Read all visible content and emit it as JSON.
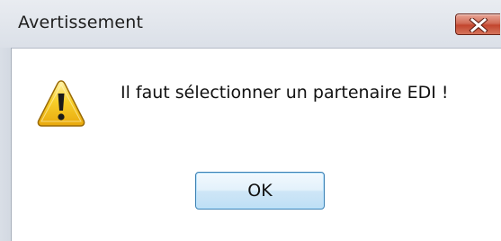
{
  "dialog": {
    "title": "Avertissement",
    "message": "Il faut sélectionner un partenaire EDI !",
    "ok_label": "OK",
    "icon": "warning-icon",
    "close_icon": "close-icon"
  },
  "colors": {
    "close_button": "#c7503a",
    "warning_yellow": "#f5c61f",
    "button_border": "#3c7fb1",
    "titlebar": "#dfe3ea"
  }
}
